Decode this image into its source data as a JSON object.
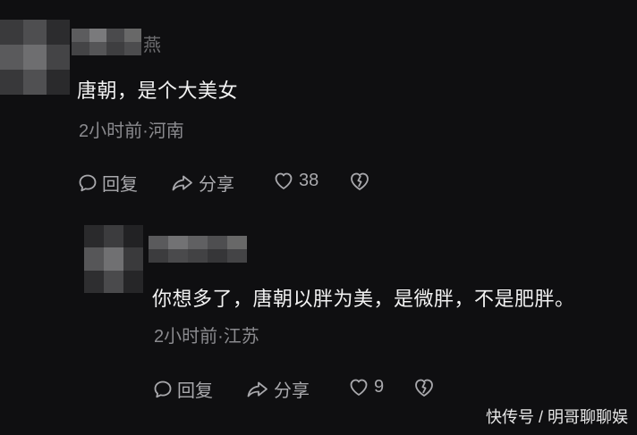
{
  "comments": [
    {
      "username_fragment": "燕",
      "text": "唐朝，是个大美女",
      "meta": "2小时前·河南",
      "actions": {
        "reply_label": "回复",
        "share_label": "分享",
        "like_count": "38"
      },
      "icons": {
        "reply": "reply-bubble-icon",
        "share": "share-arrow-icon",
        "like": "heart-icon",
        "dislike": "broken-heart-icon"
      }
    },
    {
      "text": "你想多了，唐朝以胖为美，是微胖，不是肥胖。",
      "meta": "2小时前·江苏",
      "actions": {
        "reply_label": "回复",
        "share_label": "分享",
        "like_count": "9"
      },
      "icons": {
        "reply": "reply-bubble-icon",
        "share": "share-arrow-icon",
        "like": "heart-icon",
        "dislike": "broken-heart-icon"
      }
    }
  ],
  "watermark": "快传号 / 明哥聊聊娱",
  "colors": {
    "background": "#0f0f11",
    "comment_text": "#f2f2f2",
    "meta_text": "#8a8a8e",
    "action_text": "#a9a9ad"
  }
}
